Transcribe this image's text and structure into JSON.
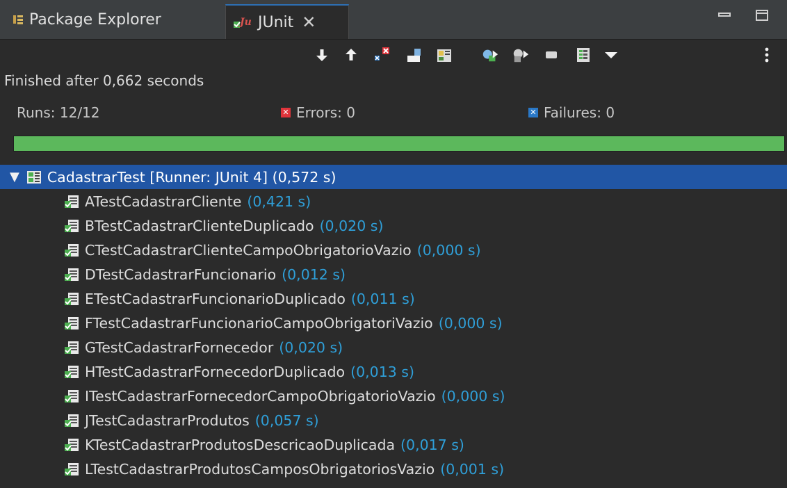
{
  "tabs": {
    "package_explorer": "Package Explorer",
    "junit": "JUnit",
    "close_symbol": "✕"
  },
  "toolbar_icons": [
    "next-failure-icon",
    "previous-failure-icon",
    "show-failures-only-icon",
    "scroll-lock-icon",
    "show-skipped-icon",
    "rerun-test-icon",
    "rerun-failed-first-icon",
    "stop-icon",
    "test-run-history-icon",
    "view-menu-icon",
    "more-icon"
  ],
  "status": "Finished after 0,662 seconds",
  "counters": {
    "runs": "Runs: 12/12",
    "errors": "Errors: 0",
    "failures": "Failures: 0"
  },
  "progress": 1.0,
  "colors": {
    "accent": "#2156a5",
    "success": "#5cb85c",
    "time": "#2f9fd8"
  },
  "tree": {
    "root": {
      "name": "CadastrarTest [Runner: JUnit 4] (0,572 s)"
    },
    "children": [
      {
        "name": "ATestCadastrarCliente",
        "time": "(0,421 s)"
      },
      {
        "name": "BTestCadastrarClienteDuplicado",
        "time": "(0,020 s)"
      },
      {
        "name": "CTestCadastrarClienteCampoObrigatorioVazio",
        "time": "(0,000 s)"
      },
      {
        "name": "DTestCadastrarFuncionario",
        "time": "(0,012 s)"
      },
      {
        "name": "ETestCadastrarFuncionarioDuplicado",
        "time": "(0,011 s)"
      },
      {
        "name": "FTestCadastrarFuncionarioCampoObrigatoriVazio",
        "time": "(0,000 s)"
      },
      {
        "name": "GTestCadastrarFornecedor",
        "time": "(0,020 s)"
      },
      {
        "name": "HTestCadastrarFornecedorDuplicado",
        "time": "(0,013 s)"
      },
      {
        "name": "ITestCadastrarFornecedorCampoObrigatorioVazio",
        "time": "(0,000 s)"
      },
      {
        "name": "JTestCadastrarProdutos",
        "time": "(0,057 s)"
      },
      {
        "name": "KTestCadastrarProdutosDescricaoDuplicada",
        "time": "(0,017 s)"
      },
      {
        "name": "LTestCadastrarProdutosCamposObrigatoriosVazio",
        "time": "(0,001 s)"
      }
    ]
  }
}
